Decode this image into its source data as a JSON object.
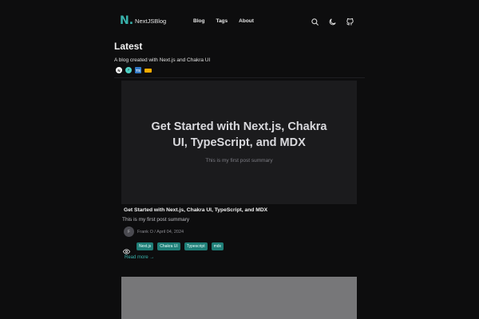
{
  "nav": {
    "logo_mark": "N.",
    "logo_text": "NextJSBlog",
    "links": [
      {
        "label": "Blog"
      },
      {
        "label": "Tags"
      },
      {
        "label": "About"
      }
    ],
    "icons": [
      "search-icon",
      "moon-icon",
      "github-icon"
    ]
  },
  "header": {
    "title": "Latest",
    "description": "A blog created with Next.js and Chakra UI",
    "tech_badges": [
      {
        "name": "nextjs-badge-icon",
        "glyph": "N"
      },
      {
        "name": "chakra-badge-icon",
        "glyph": "⚡"
      },
      {
        "name": "typescript-badge-icon",
        "glyph": "TS"
      },
      {
        "name": "mdx-badge-icon",
        "glyph": ""
      }
    ]
  },
  "posts": [
    {
      "image_title": "Get Started with Next.js, Chakra UI, TypeScript, and MDX",
      "image_subtitle": "This is my first post summary",
      "title": "Get Started with Next.js, Chakra UI, TypeScript, and MDX",
      "summary": "This is my first post summary",
      "author_initial": "F",
      "meta": "Frank O / April 04, 2024",
      "tags": [
        "Next.js",
        "Chakra UI",
        "Typescript",
        "mdx"
      ],
      "read_more": "Read more →"
    }
  ],
  "colors": {
    "background": "#0d0d0e",
    "accent": "#38b2ac",
    "tag_bg": "#1f7f78"
  }
}
